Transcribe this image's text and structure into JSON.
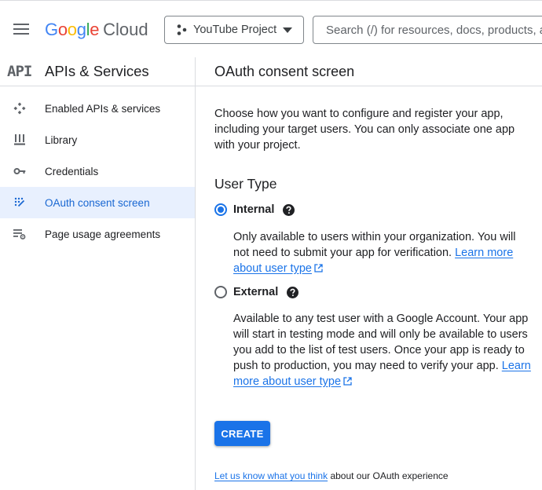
{
  "topbar": {
    "menu_icon": "hamburger-menu-icon",
    "logo": {
      "letters": [
        "G",
        "o",
        "o",
        "g",
        "l",
        "e"
      ],
      "letter_colors": [
        "#4285f4",
        "#ea4335",
        "#fbbc04",
        "#4285f4",
        "#34a853",
        "#ea4335"
      ],
      "product": "Cloud"
    },
    "project": {
      "icon": "project-hierarchy-icon",
      "label": "YouTube Project"
    },
    "search": {
      "placeholder": "Search (/) for resources, docs, products, and more"
    }
  },
  "sidebar": {
    "badge": "API",
    "title": "APIs & Services",
    "items": [
      {
        "label": "Enabled APIs & services",
        "icon": "enabled-apis-icon",
        "active": false
      },
      {
        "label": "Library",
        "icon": "library-icon",
        "active": false
      },
      {
        "label": "Credentials",
        "icon": "key-icon",
        "active": false
      },
      {
        "label": "OAuth consent screen",
        "icon": "oauth-icon",
        "active": true
      },
      {
        "label": "Page usage agreements",
        "icon": "settings-list-icon",
        "active": false
      }
    ]
  },
  "main": {
    "title": "OAuth consent screen",
    "intro": "Choose how you want to configure and register your app, including your target users. You can only associate one app with your project.",
    "user_type": {
      "heading": "User Type",
      "options": [
        {
          "label": "Internal",
          "selected": true,
          "description": "Only available to users within your organization. You will not need to submit your app for verification.",
          "link": "Learn more about user type"
        },
        {
          "label": "External",
          "selected": false,
          "description": "Available to any test user with a Google Account. Your app will start in testing mode and will only be available to users you add to the list of test users. Once your app is ready to push to production, you may need to verify your app.",
          "link": "Learn more about user type"
        }
      ]
    },
    "create_button": "CREATE",
    "feedback": {
      "link": "Let us know what you think",
      "text": "about our OAuth experience"
    }
  },
  "colors": {
    "accent": "#1a73e8",
    "active_bg": "#e8f0fe",
    "border": "#dadce0"
  }
}
